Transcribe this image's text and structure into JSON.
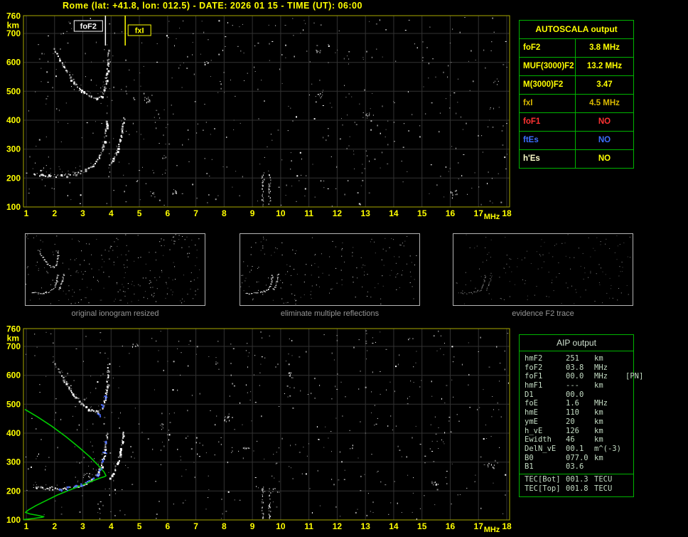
{
  "header": {
    "title": "Rome (lat: +41.8, lon: 012.5) - DATE: 2026 01 15 - TIME (UT): 06:00"
  },
  "autoscala": {
    "title": "AUTOSCALA output",
    "rows": [
      {
        "param": "foF2",
        "value": "3.8 MHz",
        "color": "#ffff00",
        "value_color": "#ffff00"
      },
      {
        "param": "MUF(3000)F2",
        "value": "13.2 MHz",
        "color": "#ffff00",
        "value_color": "#ffff00"
      },
      {
        "param": "M(3000)F2",
        "value": "3.47",
        "color": "#ffff00",
        "value_color": "#ffff00"
      },
      {
        "param": "fxI",
        "value": "4.5 MHz",
        "color": "#d9b800",
        "value_color": "#d9b800"
      },
      {
        "param": "foF1",
        "value": "NO",
        "color": "#ff3232",
        "value_color": "#ff3232"
      },
      {
        "param": "ftEs",
        "value": "NO",
        "color": "#3c6eff",
        "value_color": "#3c6eff"
      },
      {
        "param": "h'Es",
        "value": "NO",
        "color": "#ffffcc",
        "value_color": "#ffff00"
      }
    ]
  },
  "thumbnails": [
    {
      "caption": "original ionogram resized"
    },
    {
      "caption": "eliminate multiple reflections"
    },
    {
      "caption": "evidence F2 trace"
    }
  ],
  "aip": {
    "title": "AIP output",
    "rows": [
      {
        "param": "hmF2",
        "value": "251",
        "unit": "km",
        "note": ""
      },
      {
        "param": "foF2",
        "value": "03.8",
        "unit": "MHz",
        "note": ""
      },
      {
        "param": "foF1",
        "value": "00.0",
        "unit": "MHz",
        "note": "[PN]"
      },
      {
        "param": "hmF1",
        "value": "---",
        "unit": "km",
        "note": ""
      },
      {
        "param": "D1",
        "value": "00.0",
        "unit": "",
        "note": ""
      },
      {
        "param": "foE",
        "value": "1.6",
        "unit": "MHz",
        "note": ""
      },
      {
        "param": "hmE",
        "value": "110",
        "unit": "km",
        "note": ""
      },
      {
        "param": "ymE",
        "value": "20",
        "unit": "km",
        "note": ""
      },
      {
        "param": "h_vE",
        "value": "126",
        "unit": "km",
        "note": ""
      },
      {
        "param": "Ewidth",
        "value": "46",
        "unit": "km",
        "note": ""
      },
      {
        "param": "DelN_vE",
        "value": "00.1",
        "unit": "m^(-3)",
        "note": ""
      },
      {
        "param": "B0",
        "value": "077.0",
        "unit": "km",
        "note": ""
      },
      {
        "param": "B1",
        "value": "03.6",
        "unit": "",
        "note": ""
      }
    ],
    "tec_rows": [
      {
        "param": "TEC[Bot]",
        "value": "001.3",
        "unit": "TECU",
        "note": ""
      },
      {
        "param": "TEC[Top]",
        "value": "001.8",
        "unit": "TECU",
        "note": ""
      }
    ]
  },
  "colors": {
    "background": "#000000",
    "title_text": "#ffff00",
    "axis_text": "#ffff00",
    "plot_border": "#a8a800",
    "grid": "#323232",
    "table_border": "#00b400",
    "aip_text": "#c4dcc4",
    "trace": "#ffffff",
    "profile_green": "#00cc00",
    "restored_blue": "#4a6cff",
    "caption_text": "#969696"
  },
  "chart_data": [
    {
      "type": "scatter",
      "name": "ionogram-top",
      "xlabel": "MHz",
      "ylabel": "km",
      "xlim": [
        0.9,
        18.1
      ],
      "ylim": [
        100,
        770
      ],
      "x_ticks": [
        1,
        2,
        3,
        4,
        5,
        6,
        7,
        8,
        9,
        10,
        11,
        12,
        13,
        14,
        15,
        16,
        17,
        18
      ],
      "y_ticks": [
        760,
        700,
        600,
        500,
        400,
        300,
        200,
        100
      ],
      "grid": true,
      "markers": [
        {
          "name": "foF2",
          "freq_mhz": 3.8,
          "color": "#ffffff",
          "label": "foF2"
        },
        {
          "name": "fxI",
          "freq_mhz": 4.5,
          "color": "#ffff00",
          "label": "fxI"
        }
      ],
      "series": [
        {
          "name": "F2 trace O-mode 1st hop",
          "points_mhz_km": [
            [
              1.25,
              216
            ],
            [
              1.6,
              211
            ],
            [
              2.0,
              209
            ],
            [
              2.4,
              211
            ],
            [
              2.75,
              217
            ],
            [
              3.05,
              226
            ],
            [
              3.3,
              240
            ],
            [
              3.5,
              260
            ],
            [
              3.64,
              288
            ],
            [
              3.74,
              325
            ],
            [
              3.8,
              365
            ],
            [
              3.84,
              400
            ]
          ]
        },
        {
          "name": "F2 trace X-mode cusp",
          "points_mhz_km": [
            [
              3.95,
              248
            ],
            [
              4.08,
              266
            ],
            [
              4.2,
              295
            ],
            [
              4.3,
              330
            ],
            [
              4.38,
              368
            ],
            [
              4.44,
              408
            ]
          ]
        },
        {
          "name": "multiple reflection 2nd hop",
          "points_mhz_km": [
            [
              1.95,
              650
            ],
            [
              2.15,
              615
            ],
            [
              2.4,
              572
            ],
            [
              2.65,
              535
            ],
            [
              2.95,
              502
            ],
            [
              3.25,
              482
            ],
            [
              3.5,
              476
            ],
            [
              3.66,
              486
            ],
            [
              3.76,
              512
            ],
            [
              3.83,
              552
            ],
            [
              3.87,
              598
            ],
            [
              3.9,
              640
            ]
          ]
        }
      ],
      "interference_columns_mhz": [
        9.35,
        9.6
      ]
    },
    {
      "type": "scatter",
      "name": "ionogram-bottom",
      "xlabel": "MHz",
      "ylabel": "km",
      "xlim": [
        0.9,
        18.1
      ],
      "ylim": [
        100,
        770
      ],
      "x_ticks": [
        1,
        2,
        3,
        4,
        5,
        6,
        7,
        8,
        9,
        10,
        11,
        12,
        13,
        14,
        15,
        16,
        17,
        18
      ],
      "y_ticks": [
        760,
        700,
        600,
        500,
        400,
        300,
        200,
        100
      ],
      "grid": true,
      "series_note": "same echo traces as ionogram-top",
      "profile": {
        "name": "AIP electron density profile N(h)",
        "color": "#00cc00",
        "points_mhz_km": [
          [
            0.9,
            101
          ],
          [
            1.25,
            105
          ],
          [
            1.55,
            109
          ],
          [
            1.62,
            111
          ],
          [
            1.4,
            116
          ],
          [
            1.12,
            121
          ],
          [
            0.97,
            126
          ],
          [
            1.08,
            135
          ],
          [
            1.35,
            150
          ],
          [
            1.7,
            167
          ],
          [
            2.1,
            186
          ],
          [
            2.55,
            204
          ],
          [
            3.0,
            221
          ],
          [
            3.35,
            235
          ],
          [
            3.62,
            245
          ],
          [
            3.78,
            250
          ],
          [
            3.82,
            253
          ],
          [
            3.75,
            266
          ],
          [
            3.55,
            288
          ],
          [
            3.25,
            318
          ],
          [
            2.85,
            352
          ],
          [
            2.4,
            388
          ],
          [
            1.9,
            424
          ],
          [
            1.4,
            456
          ],
          [
            0.95,
            482
          ]
        ]
      },
      "restored_trace_points_mhz_km": [
        [
          2.2,
          208
        ],
        [
          2.45,
          211
        ],
        [
          2.7,
          216
        ],
        [
          2.95,
          223
        ],
        [
          3.15,
          232
        ],
        [
          3.35,
          244
        ],
        [
          3.5,
          258
        ],
        [
          3.62,
          278
        ],
        [
          3.7,
          305
        ],
        [
          3.76,
          338
        ],
        [
          3.8,
          370
        ],
        [
          3.55,
          465
        ],
        [
          3.68,
          495
        ],
        [
          3.78,
          525
        ]
      ],
      "restored_color": "#4a6cff",
      "interference_columns_mhz": [
        9.35,
        9.6
      ]
    }
  ]
}
